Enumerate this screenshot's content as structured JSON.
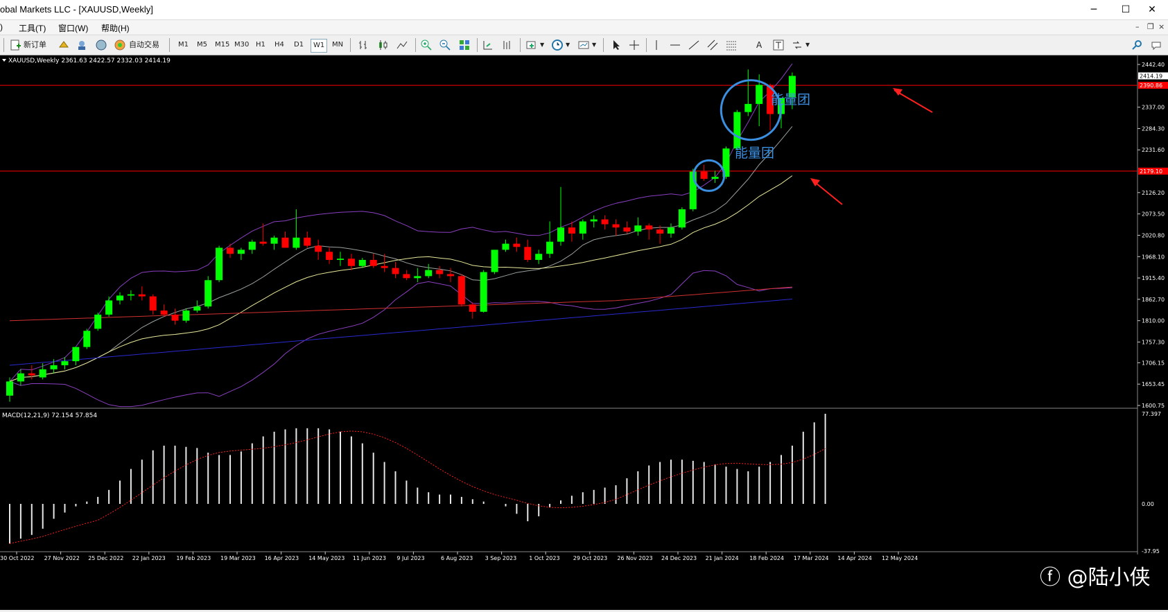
{
  "window": {
    "title": "obal Markets LLC - [XAUUSD,Weekly]",
    "minimize": "─",
    "maximize": "☐",
    "close": "✕"
  },
  "menu": {
    "items": [
      "工具(T)",
      "窗口(W)",
      "帮助(H)"
    ],
    "left_stub": ")"
  },
  "toolbar": {
    "new_order": "新订单",
    "auto_trade": "自动交易",
    "timeframes": [
      "M1",
      "M5",
      "M15",
      "M30",
      "H1",
      "H4",
      "D1",
      "W1",
      "MN"
    ],
    "active_timeframe": "W1",
    "text_tool": "A"
  },
  "chart": {
    "symbol_info": "XAUUSD,Weekly  2361.63 2422.57 2332.03 2414.19",
    "price_labels": [
      "2442.40",
      "2414.19",
      "2337.00",
      "2284.30",
      "2231.60",
      "2126.20",
      "2073.50",
      "2020.80",
      "1968.10",
      "1915.40",
      "1862.70",
      "1810.00",
      "1757.30",
      "1706.15",
      "1653.45",
      "1600.75"
    ],
    "current_price": "2414.19",
    "hline_labels": [
      "2390.86",
      "2179.10"
    ],
    "annotations": [
      "能量团",
      "能量团"
    ],
    "date_labels": [
      "30 Oct 2022",
      "27 Nov 2022",
      "25 Dec 2022",
      "22 Jan 2023",
      "19 Feb 2023",
      "19 Mar 2023",
      "16 Apr 2023",
      "14 May 2023",
      "11 Jun 2023",
      "9 Jul 2023",
      "6 Aug 2023",
      "3 Sep 2023",
      "1 Oct 2023",
      "29 Oct 2023",
      "26 Nov 2023",
      "24 Dec 2023",
      "21 Jan 2024",
      "18 Feb 2024",
      "17 Mar 2024",
      "14 Apr 2024",
      "12 May 2024"
    ],
    "colors": {
      "background": "#000000",
      "bull": "#00ff00",
      "bear": "#ff0000",
      "hline": "#ff0000",
      "annotation": "#3b8fe0"
    }
  },
  "macd": {
    "label": "MACD(12,21,9) 72.154 57.854",
    "scale_labels": [
      "77.397",
      "0.00",
      "-37.95"
    ]
  },
  "chart_data": {
    "type": "candlestick",
    "symbol": "XAUUSD",
    "timeframe": "Weekly",
    "ohlc": [
      [
        1625,
        1670,
        1610,
        1660
      ],
      [
        1660,
        1690,
        1650,
        1680
      ],
      [
        1680,
        1700,
        1665,
        1675
      ],
      [
        1670,
        1705,
        1665,
        1690
      ],
      [
        1690,
        1715,
        1680,
        1700
      ],
      [
        1700,
        1720,
        1690,
        1710
      ],
      [
        1710,
        1730,
        1700,
        1745
      ],
      [
        1745,
        1790,
        1740,
        1785
      ],
      [
        1790,
        1830,
        1785,
        1825
      ],
      [
        1825,
        1870,
        1820,
        1860
      ],
      [
        1860,
        1880,
        1850,
        1872
      ],
      [
        1872,
        1885,
        1860,
        1875
      ],
      [
        1875,
        1895,
        1860,
        1870
      ],
      [
        1870,
        1875,
        1825,
        1835
      ],
      [
        1835,
        1850,
        1820,
        1825
      ],
      [
        1825,
        1840,
        1800,
        1810
      ],
      [
        1810,
        1840,
        1805,
        1835
      ],
      [
        1835,
        1860,
        1830,
        1845
      ],
      [
        1845,
        1920,
        1840,
        1910
      ],
      [
        1910,
        1995,
        1905,
        1990
      ],
      [
        1990,
        2000,
        1965,
        1975
      ],
      [
        1975,
        1990,
        1960,
        1985
      ],
      [
        1985,
        2010,
        1975,
        2005
      ],
      [
        2005,
        2050,
        1995,
        2000
      ],
      [
        2000,
        2020,
        1985,
        2015
      ],
      [
        2015,
        2030,
        1995,
        1990
      ],
      [
        1990,
        2085,
        1985,
        2015
      ],
      [
        2015,
        2030,
        1990,
        1995
      ],
      [
        1995,
        2010,
        1960,
        1980
      ],
      [
        1980,
        1990,
        1950,
        1960
      ],
      [
        1960,
        1980,
        1945,
        1963
      ],
      [
        1963,
        1975,
        1935,
        1945
      ],
      [
        1945,
        1965,
        1940,
        1960
      ],
      [
        1960,
        1975,
        1940,
        1945
      ],
      [
        1945,
        1975,
        1930,
        1940
      ],
      [
        1940,
        1955,
        1915,
        1925
      ],
      [
        1925,
        1935,
        1910,
        1915
      ],
      [
        1915,
        1940,
        1905,
        1920
      ],
      [
        1920,
        1950,
        1915,
        1935
      ],
      [
        1935,
        1945,
        1915,
        1925
      ],
      [
        1925,
        1940,
        1905,
        1920
      ],
      [
        1920,
        1925,
        1845,
        1850
      ],
      [
        1850,
        1855,
        1815,
        1832
      ],
      [
        1832,
        1935,
        1830,
        1930
      ],
      [
        1930,
        1985,
        1925,
        1985
      ],
      [
        1985,
        2010,
        1980,
        2000
      ],
      [
        2000,
        2015,
        1980,
        1992
      ],
      [
        1992,
        2010,
        1955,
        1960
      ],
      [
        1960,
        1985,
        1950,
        1975
      ],
      [
        1975,
        2055,
        1965,
        2005
      ],
      [
        2005,
        2140,
        1995,
        2040
      ],
      [
        2040,
        2055,
        2005,
        2025
      ],
      [
        2025,
        2060,
        2010,
        2055
      ],
      [
        2055,
        2070,
        2040,
        2060
      ],
      [
        2060,
        2070,
        2035,
        2048
      ],
      [
        2048,
        2060,
        2020,
        2040
      ],
      [
        2040,
        2055,
        2025,
        2030
      ],
      [
        2030,
        2065,
        2020,
        2045
      ],
      [
        2045,
        2050,
        2010,
        2035
      ],
      [
        2035,
        2045,
        2000,
        2025
      ],
      [
        2025,
        2050,
        2015,
        2040
      ],
      [
        2040,
        2090,
        2035,
        2085
      ],
      [
        2085,
        2185,
        2080,
        2178
      ],
      [
        2178,
        2195,
        2155,
        2160
      ],
      [
        2160,
        2180,
        2150,
        2165
      ],
      [
        2165,
        2240,
        2160,
        2235
      ],
      [
        2235,
        2330,
        2230,
        2325
      ],
      [
        2325,
        2430,
        2315,
        2345
      ],
      [
        2345,
        2418,
        2290,
        2392
      ],
      [
        2392,
        2395,
        2280,
        2320
      ],
      [
        2320,
        2360,
        2285,
        2360
      ],
      [
        2361.63,
        2422.57,
        2332.03,
        2414.19
      ]
    ],
    "macd_histogram": [
      -32,
      -28,
      -25,
      -20,
      -12,
      -7,
      -2,
      2,
      6,
      12,
      20,
      30,
      38,
      46,
      50,
      50,
      49,
      48,
      44,
      42,
      42,
      45,
      52,
      58,
      62,
      64,
      65,
      65,
      65,
      64,
      62,
      58,
      52,
      44,
      36,
      28,
      20,
      14,
      10,
      8,
      8,
      6,
      4,
      2,
      0,
      -2,
      -8,
      -14,
      -10,
      -3,
      3,
      7,
      10,
      12,
      14,
      16,
      22,
      28,
      33,
      36,
      38,
      38,
      37,
      36,
      34,
      32,
      30,
      28,
      32,
      36,
      42,
      50,
      62,
      70,
      77.4
    ]
  }
}
